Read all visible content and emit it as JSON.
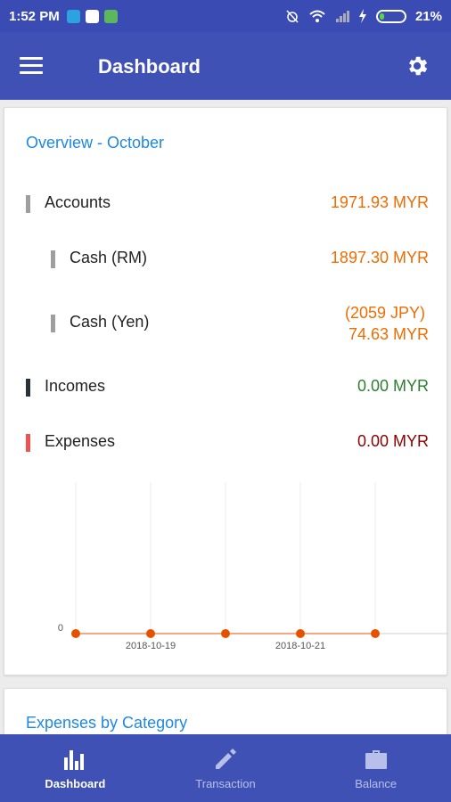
{
  "statusbar": {
    "time": "1:52 PM",
    "battery": "21%",
    "battery_level": 0.21
  },
  "appbar": {
    "title": "Dashboard"
  },
  "overview": {
    "title": "Overview - October",
    "accounts": {
      "label": "Accounts",
      "amount": "1971.93 MYR"
    },
    "cash_rm": {
      "label": "Cash (RM)",
      "amount": "1897.30 MYR"
    },
    "cash_yen": {
      "label": "Cash (Yen)",
      "amount_line1": "(2059 JPY)",
      "amount_line2": "74.63 MYR"
    },
    "incomes": {
      "label": "Incomes",
      "amount": "0.00 MYR"
    },
    "expenses": {
      "label": "Expenses",
      "amount": "0.00 MYR"
    }
  },
  "colors": {
    "accounts_bar": "#9e9e9e",
    "income_bar": "#263238",
    "expense_bar": "#ef5350",
    "accent_orange": "#ef6c00",
    "income_green": "#2e7d32",
    "expense_red": "#8b0000",
    "title_blue": "#1e88e5",
    "appbar": "#3f51b5"
  },
  "chart_data": {
    "type": "line",
    "x": [
      "2018-10-18",
      "2018-10-19",
      "2018-10-20",
      "2018-10-21",
      "2018-10-22"
    ],
    "x_tick_labels": [
      "2018-10-19",
      "2018-10-21"
    ],
    "series": [
      {
        "values": [
          0,
          0,
          0,
          0,
          0
        ],
        "color": "#e65100"
      }
    ],
    "y_tick_labels": [
      "0"
    ],
    "grid": true
  },
  "expenses_section": {
    "title": "Expenses by Category"
  },
  "bottom_nav": {
    "items": [
      {
        "label": "Dashboard",
        "icon": "bar-chart-icon",
        "active": true
      },
      {
        "label": "Transaction",
        "icon": "pencil-icon",
        "active": false
      },
      {
        "label": "Balance",
        "icon": "briefcase-icon",
        "active": false
      }
    ]
  }
}
